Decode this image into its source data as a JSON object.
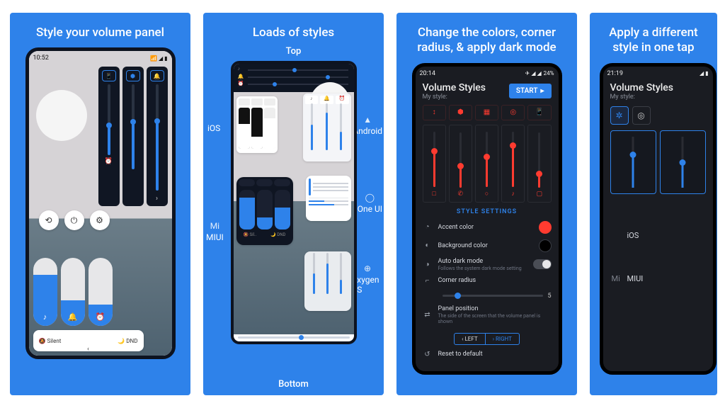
{
  "cards": [
    {
      "title": "Style your volume panel",
      "statusbar_time": "10:52",
      "toast_silent": "Silent",
      "toast_dnd": "DND"
    },
    {
      "title": "Loads of styles",
      "top_label": "Top",
      "bottom_label": "Bottom",
      "os_left_1": "iOS",
      "os_left_2": "MIUI",
      "os_right_1": "Android",
      "os_right_2": "One UI",
      "os_right_3": "Oxygen OS"
    },
    {
      "title": "Change the colors, corner radius, & apply dark mode",
      "statusbar_time": "20:14",
      "statusbar_batt": "24%",
      "header_title": "Volume Styles",
      "header_sub": "My style:",
      "start_label": "START",
      "section": "STYLE SETTINGS",
      "rows": {
        "accent": "Accent color",
        "bg": "Background color",
        "dark": "Auto dark mode",
        "dark_sub": "Follows the system dark mode setting",
        "corner": "Corner radius",
        "corner_val": "5",
        "panel_pos": "Panel position",
        "panel_pos_sub": "The side of the screen that the volume panel is shown",
        "left": "LEFT",
        "right": "RIGHT",
        "reset": "Reset to default"
      }
    },
    {
      "title": "Apply a different style in one tap",
      "statusbar_time": "21:19",
      "header_title": "Volume Styles",
      "header_sub": "My style:",
      "os_ios": "iOS",
      "os_miui": "MIUI"
    }
  ]
}
